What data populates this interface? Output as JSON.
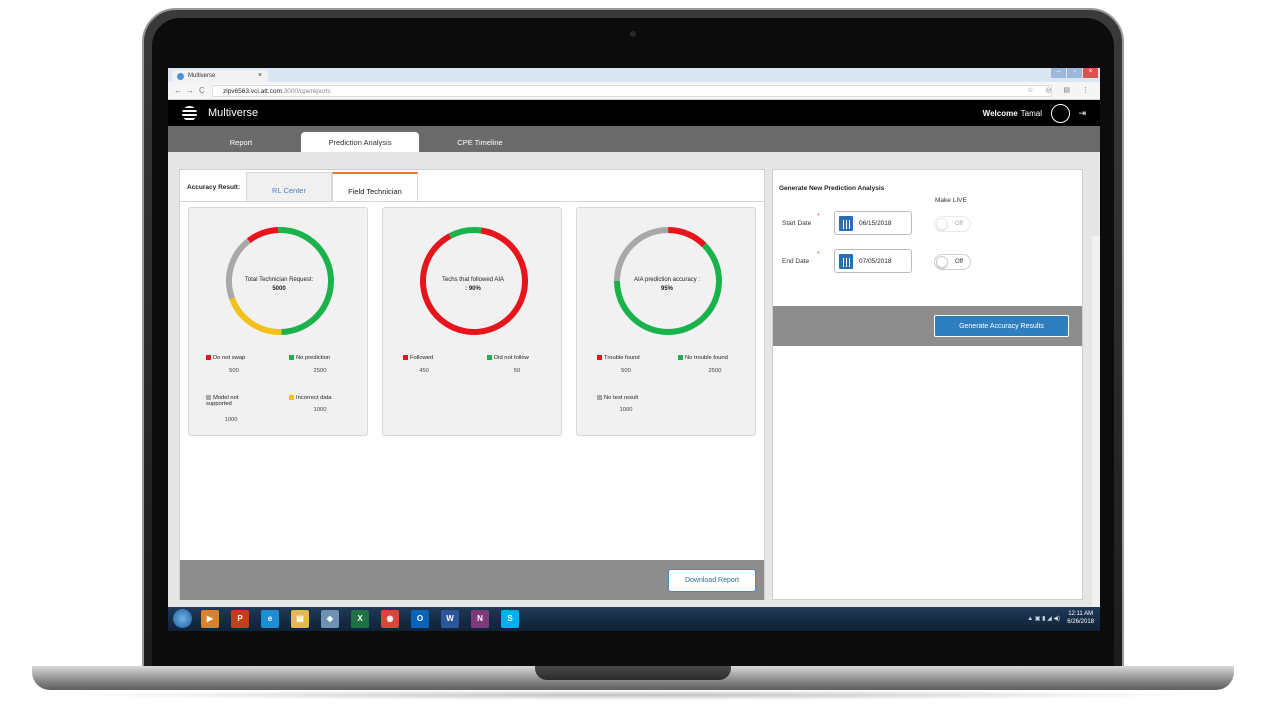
{
  "browser": {
    "tab_title": "Multiverse",
    "tab_close": "×",
    "url_domain": "zlpv6563.vci.att.com",
    "url_path": ":3000/cpereports",
    "nav_back": "←",
    "nav_forward": "→",
    "nav_reload": "C",
    "addr_right_icons": "☆ ◎ ▤ ⋮"
  },
  "header": {
    "brand": "Multiverse",
    "welcome_label": "Welcome",
    "user_name": "Tamal"
  },
  "main_tabs": [
    {
      "label": "Report"
    },
    {
      "label": "Prediction Analysis"
    },
    {
      "label": "CPE Timeline"
    }
  ],
  "accuracy": {
    "label": "Accuracy Result:",
    "tabs": [
      {
        "label": "RL Center"
      },
      {
        "label": "Field Technician"
      }
    ]
  },
  "colors": {
    "red": "#e8141b",
    "green": "#19b24b",
    "yellow": "#f5c01b",
    "gray": "#a8a8a8"
  },
  "cards": [
    {
      "title": "Total Technician Request:",
      "value": "5000",
      "segments": [
        {
          "name": "Do not swap",
          "value": 500,
          "color": "#e8141b"
        },
        {
          "name": "No prediction",
          "value": 2500,
          "color": "#19b24b"
        },
        {
          "name": "Model not supported",
          "value": 1000,
          "color": "#a8a8a8"
        },
        {
          "name": "Incorrect data",
          "value": 1000,
          "color": "#f5c01b"
        }
      ],
      "legend": [
        {
          "label": "Do not swap",
          "value": "500"
        },
        {
          "label": "No prediction",
          "value": "2500"
        },
        {
          "label": "Model not supported",
          "value": "1000"
        },
        {
          "label": "Incorrect data",
          "value": "1000"
        }
      ]
    },
    {
      "title": "Techs that followed AIA",
      "value": ": 90%",
      "segments": [
        {
          "name": "Followed",
          "value": 450,
          "color": "#e8141b"
        },
        {
          "name": "Did not follow",
          "value": 50,
          "color": "#19b24b"
        }
      ],
      "legend": [
        {
          "label": "Followed",
          "value": "450"
        },
        {
          "label": "Did not follow",
          "value": "50"
        }
      ]
    },
    {
      "title": "AIA prediction accuracy :",
      "value": "95%",
      "segments": [
        {
          "name": "Trouble found",
          "value": 500,
          "color": "#e8141b"
        },
        {
          "name": "No trouble found",
          "value": 2500,
          "color": "#19b24b"
        },
        {
          "name": "No test result",
          "value": 1000,
          "color": "#a8a8a8"
        }
      ],
      "legend": [
        {
          "label": "Trouble found",
          "value": "500"
        },
        {
          "label": "No trouble found",
          "value": "2500"
        },
        {
          "label": "No test result",
          "value": "1000"
        }
      ]
    }
  ],
  "download_label": "Download Report",
  "right_panel": {
    "title": "Generate New Prediction Analysis",
    "make_live": "Make LIVE",
    "start_label": "Start Date",
    "end_label": "End Date",
    "required_mark": "*",
    "start_date": "06/15/2018",
    "end_date": "07/05/2018",
    "toggle1": "Off",
    "toggle2": "Off",
    "generate_label": "Generate Accuracy Results"
  },
  "taskbar": {
    "icons": [
      {
        "name": "media-player-icon",
        "glyph": "▶",
        "color": "#d9822b"
      },
      {
        "name": "powerpoint-icon",
        "glyph": "P",
        "color": "#c43e1c"
      },
      {
        "name": "ie-icon",
        "glyph": "e",
        "color": "#1f8dd6"
      },
      {
        "name": "file-explorer-icon",
        "glyph": "▤",
        "color": "#e4b84a"
      },
      {
        "name": "notes-icon",
        "glyph": "◈",
        "color": "#6f8fb5"
      },
      {
        "name": "excel-icon",
        "glyph": "X",
        "color": "#1e7145"
      },
      {
        "name": "chrome-icon",
        "glyph": "◉",
        "color": "#db4437"
      },
      {
        "name": "outlook-icon",
        "glyph": "O",
        "color": "#0a64b5"
      },
      {
        "name": "word-icon",
        "glyph": "W",
        "color": "#2b579a"
      },
      {
        "name": "onenote-icon",
        "glyph": "N",
        "color": "#80397b"
      },
      {
        "name": "skype-icon",
        "glyph": "S",
        "color": "#00aff0"
      }
    ],
    "tray": "▲ ▣ ▮ ◢ ◀)",
    "time": "12:11 AM",
    "date": "6/26/2018"
  }
}
